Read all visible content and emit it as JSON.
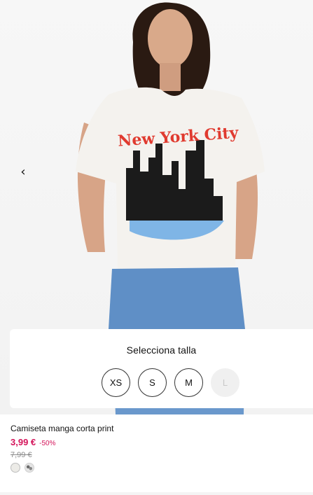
{
  "gallery": {
    "prev_arrow": "‹",
    "print_text": "New York City",
    "print_text_color": "#e03a2f"
  },
  "size_selector": {
    "title": "Selecciona talla",
    "sizes": [
      {
        "label": "XS",
        "available": true
      },
      {
        "label": "S",
        "available": true
      },
      {
        "label": "M",
        "available": true
      },
      {
        "label": "L",
        "available": false
      }
    ]
  },
  "product": {
    "name": "Camiseta manga corta print",
    "price": "3,99 €",
    "discount": "-50%",
    "old_price": "7,99 €",
    "price_color": "#d4145a",
    "colors": [
      "white",
      "print"
    ]
  }
}
